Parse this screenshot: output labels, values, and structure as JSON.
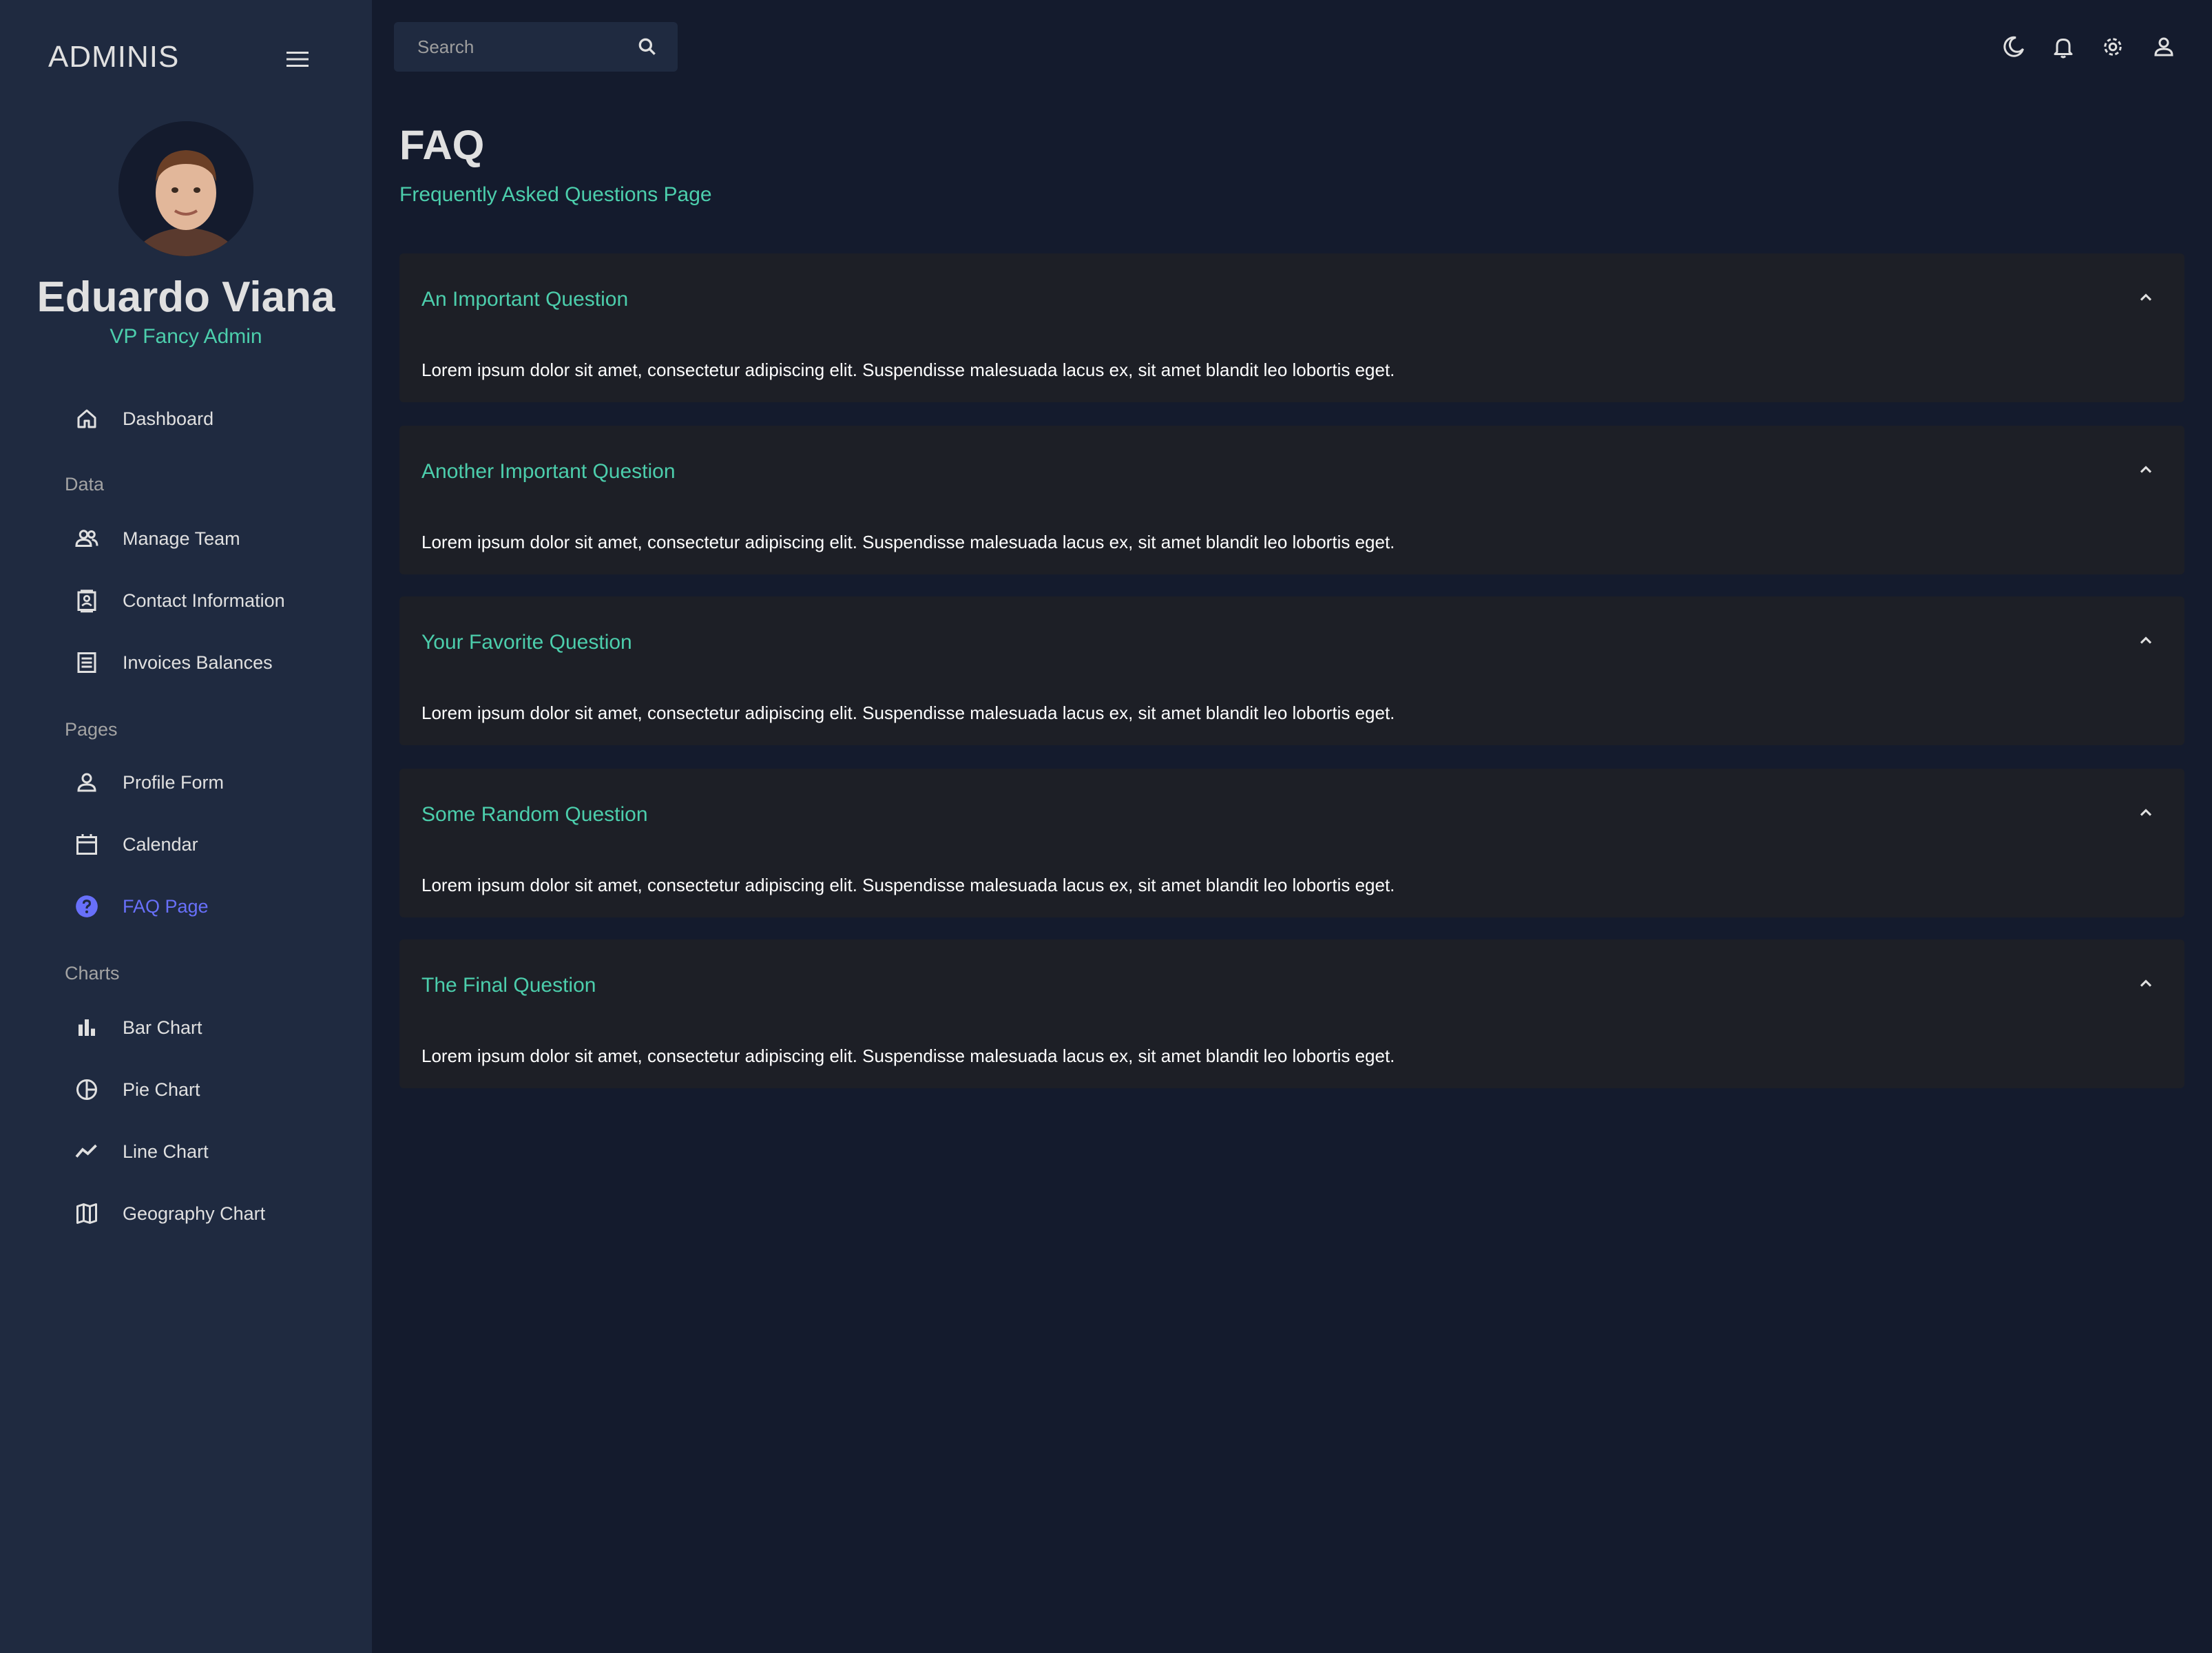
{
  "sidebar": {
    "brand": "ADMINIS",
    "user": {
      "name": "Eduardo Viana",
      "role": "VP Fancy Admin"
    },
    "items": [
      {
        "label": "Dashboard",
        "icon": "home-icon"
      },
      {
        "section": "Data"
      },
      {
        "label": "Manage Team",
        "icon": "people-icon"
      },
      {
        "label": "Contact Information",
        "icon": "contacts-icon"
      },
      {
        "label": "Invoices Balances",
        "icon": "receipt-icon"
      },
      {
        "section": "Pages"
      },
      {
        "label": "Profile Form",
        "icon": "person-icon"
      },
      {
        "label": "Calendar",
        "icon": "calendar-icon"
      },
      {
        "label": "FAQ Page",
        "icon": "help-icon",
        "active": true
      },
      {
        "section": "Charts"
      },
      {
        "label": "Bar Chart",
        "icon": "bar-chart-icon"
      },
      {
        "label": "Pie Chart",
        "icon": "pie-chart-icon"
      },
      {
        "label": "Line Chart",
        "icon": "line-chart-icon"
      },
      {
        "label": "Geography Chart",
        "icon": "map-icon"
      }
    ]
  },
  "topbar": {
    "search_placeholder": "Search",
    "icons": [
      "dark-mode-icon",
      "notifications-icon",
      "settings-icon",
      "profile-icon"
    ]
  },
  "header": {
    "title": "FAQ",
    "subtitle": "Frequently Asked Questions Page"
  },
  "faq": [
    {
      "question": "An Important Question",
      "answer": "Lorem ipsum dolor sit amet, consectetur adipiscing elit. Suspendisse malesuada lacus ex, sit amet blandit leo lobortis eget.",
      "expanded": true
    },
    {
      "question": "Another Important Question",
      "answer": "Lorem ipsum dolor sit amet, consectetur adipiscing elit. Suspendisse malesuada lacus ex, sit amet blandit leo lobortis eget.",
      "expanded": true
    },
    {
      "question": "Your Favorite Question",
      "answer": "Lorem ipsum dolor sit amet, consectetur adipiscing elit. Suspendisse malesuada lacus ex, sit amet blandit leo lobortis eget.",
      "expanded": true
    },
    {
      "question": "Some Random Question",
      "answer": "Lorem ipsum dolor sit amet, consectetur adipiscing elit. Suspendisse malesuada lacus ex, sit amet blandit leo lobortis eget.",
      "expanded": true
    },
    {
      "question": "The Final Question",
      "answer": "Lorem ipsum dolor sit amet, consectetur adipiscing elit. Suspendisse malesuada lacus ex, sit amet blandit leo lobortis eget.",
      "expanded": true
    }
  ],
  "colors": {
    "background": "#141b2d",
    "sidebar": "#1f2a40",
    "accent_green": "#4cceac",
    "accent_active": "#6870fa",
    "panel": "#1d1f26"
  }
}
